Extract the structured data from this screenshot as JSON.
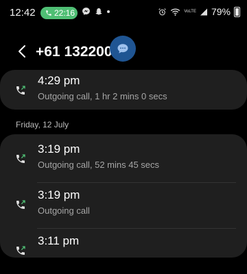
{
  "status_bar": {
    "time": "12:42",
    "call_duration": "22:16",
    "battery": "79%",
    "signal_label": "VoLTE",
    "battery_level": 0.79
  },
  "header": {
    "title": "+61 132200"
  },
  "recent": [
    {
      "time": "4:29 pm",
      "description": "Outgoing call, 1 hr 2 mins 0 secs"
    }
  ],
  "date_group": {
    "label": "Friday, 12 July",
    "entries": [
      {
        "time": "3:19 pm",
        "description": "Outgoing call, 52 mins 45 secs"
      },
      {
        "time": "3:19 pm",
        "description": "Outgoing call"
      },
      {
        "time": "3:11 pm",
        "description": ""
      }
    ]
  },
  "colors": {
    "background": "#000000",
    "card": "#1f1f1f",
    "call_pill": "#4fbe74",
    "fab": "#1f5593",
    "outgoing_arrow": "#4fbe74"
  }
}
